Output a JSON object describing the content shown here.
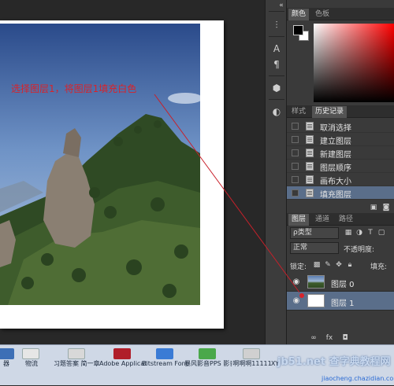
{
  "canvas": {
    "annotation": "选择图层1，将图层1填充白色"
  },
  "tools": [
    {
      "icon": "paragraph-align-icon",
      "glyph": "⫶"
    },
    {
      "icon": "character-icon",
      "glyph": "A"
    },
    {
      "icon": "paragraph-icon",
      "glyph": "¶"
    },
    {
      "icon": "3d-cube-icon",
      "glyph": "⬢"
    },
    {
      "icon": "brush-preset-icon",
      "glyph": "◐"
    }
  ],
  "color_panel": {
    "tabs": [
      "颜色",
      "色板"
    ],
    "foreground": "#000000",
    "background": "#ffffff"
  },
  "history_panel": {
    "tabs": [
      "样式",
      "历史记录"
    ],
    "items": [
      {
        "label": "取消选择",
        "selected": false
      },
      {
        "label": "建立图层",
        "selected": false
      },
      {
        "label": "新建图层",
        "selected": false
      },
      {
        "label": "图层顺序",
        "selected": false
      },
      {
        "label": "画布大小",
        "selected": false
      },
      {
        "label": "填充图层",
        "selected": true
      }
    ]
  },
  "layers_panel": {
    "tabs": [
      "图层",
      "通道",
      "路径"
    ],
    "filter_kind": "ρ类型",
    "blend_mode": "正常",
    "opacity_label": "不透明度:",
    "lock_label": "锁定:",
    "fill_label": "填充:",
    "layers": [
      {
        "name": "图层 0",
        "selected": false
      },
      {
        "name": "图层 1",
        "selected": true
      }
    ]
  },
  "taskbar": {
    "items": [
      {
        "label": "器",
        "color": "#3d6fb6"
      },
      {
        "label": "物流",
        "color": "#e6e6e6"
      },
      {
        "label": "习题答案 简一章 总论 一",
        "color": "#d8d8d8"
      },
      {
        "label": "Adobe Applicati...",
        "color": "#b01e2a"
      },
      {
        "label": "Bitstream Font Na...",
        "color": "#3a7bd5"
      },
      {
        "label": "暴风影音PPS 影音",
        "color": "#4aa84a"
      },
      {
        "label": "啊啊啊11111",
        "color": "#d0d0d0"
      },
      {
        "label": "XY",
        "color": "#d0d0d0"
      }
    ],
    "watermark": "jb51.net 查字典教程网",
    "watermark_url": "jiaocheng.chazidian.com"
  },
  "collapse_arrows": "«"
}
